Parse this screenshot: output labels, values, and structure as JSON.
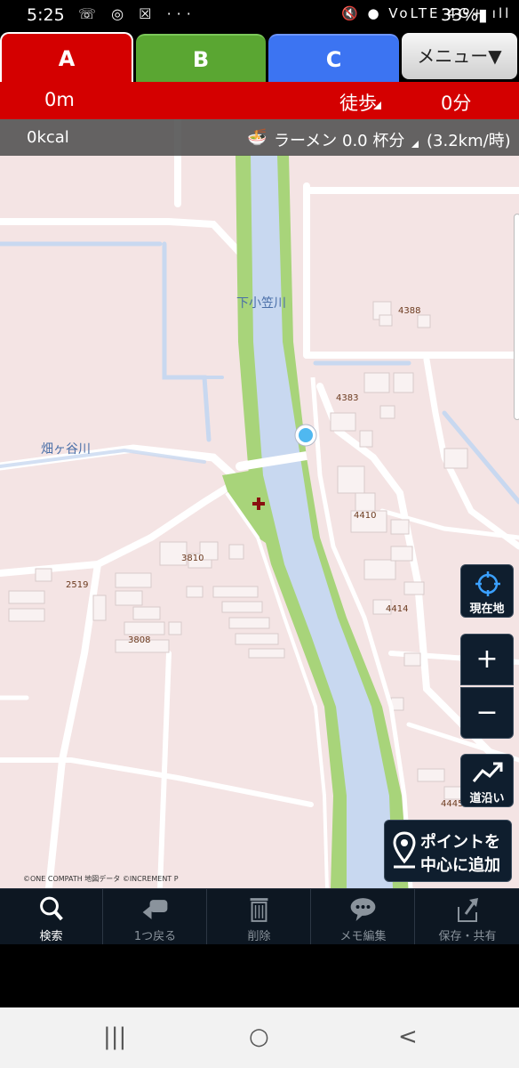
{
  "status_bar": {
    "time": "5:25",
    "left_icons": "☏ ◎ ☒ ···",
    "right_icons": "🔇 ● VoLTE 4G+ ıll",
    "battery": "33%▮"
  },
  "tabs": [
    {
      "label": "A",
      "color": "#d40000",
      "active": true
    },
    {
      "label": "B",
      "color": "#5aa632"
    },
    {
      "label": "C",
      "color": "#3c74f2"
    }
  ],
  "menu": {
    "label": "メニュー▼"
  },
  "info": {
    "distance": "0m",
    "mode": "徒歩",
    "minutes": "0分"
  },
  "calorie": {
    "kcal": "0kcal",
    "food_icon": "🍜",
    "food_text": "ラーメン 0.0 杯分",
    "speed": "(3.2km/時)"
  },
  "map": {
    "river_labels": [
      "下小笠川",
      "畑ヶ谷川"
    ],
    "addresses": [
      "4388",
      "4383",
      "4410",
      "3810",
      "2519",
      "4414",
      "3808",
      "4445"
    ],
    "copyright": "©ONE COMPATH 地図データ ©INCREMENT P",
    "colors": {
      "land": "#f4e4e4",
      "river": "#c8d8f0",
      "bank": "#a8d47a",
      "road": "#ffffff"
    }
  },
  "map_buttons": {
    "current_location": "現在地",
    "zoom_in": "+",
    "zoom_out": "−",
    "along_road": "道沿い",
    "add_point_line1": "ポイントを",
    "add_point_line2": "中心に追加"
  },
  "toolbar": [
    {
      "label": "検索",
      "icon": "search-icon"
    },
    {
      "label": "1つ戻る",
      "icon": "undo-icon"
    },
    {
      "label": "削除",
      "icon": "trash-icon"
    },
    {
      "label": "メモ編集",
      "icon": "speech-bubble-icon"
    },
    {
      "label": "保存・共有",
      "icon": "share-icon"
    }
  ],
  "nav": {
    "recent": "|||",
    "home": "○",
    "back": "<"
  }
}
